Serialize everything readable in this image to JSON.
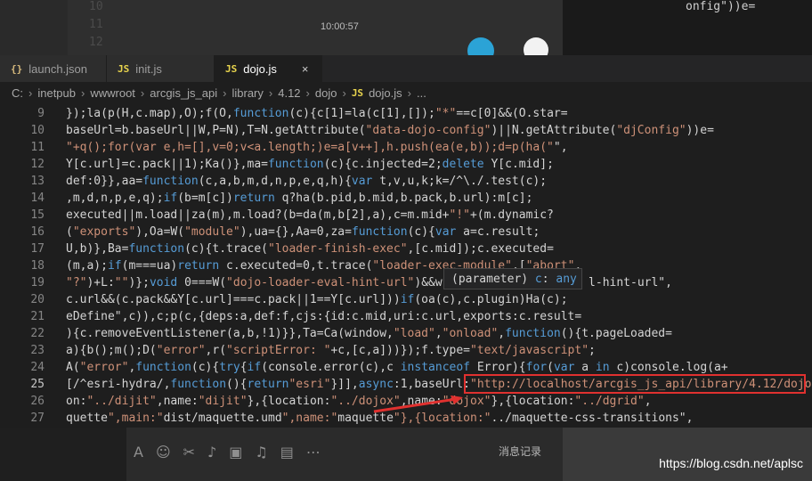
{
  "background": {
    "line_numbers": [
      "10",
      "11",
      "12"
    ],
    "right_text": "onfig\"))e=",
    "chat_time": "10:00:57",
    "chat_record_label": "消息记录",
    "watermark": "https://blog.csdn.net/aplsc"
  },
  "tabs": [
    {
      "icon": "{}",
      "label": "launch.json",
      "active": false
    },
    {
      "icon": "JS",
      "label": "init.js",
      "active": false
    },
    {
      "icon": "JS",
      "label": "dojo.js",
      "active": true,
      "close": "×"
    }
  ],
  "breadcrumb": [
    "C:",
    "inetpub",
    "wwwroot",
    "arcgis_js_api",
    "library",
    "4.12",
    "dojo",
    "dojo.js",
    "..."
  ],
  "breadcrumb_file_icon": "JS",
  "current_line": "25",
  "lines": [
    {
      "n": "9",
      "t": "});la(p(H,c.map),O);f(O,function(c){c[1]=la(c[1],[]);\"*\"==c[0]&&(O.star="
    },
    {
      "n": "10",
      "t": "baseUrl=b.baseUrl||W,P=N),T=N.getAttribute(\"data-dojo-config\")||N.getAttribute(\"djConfig\"))e="
    },
    {
      "n": "11",
      "t": "\"+q();for(var e,h=[],v=0;v<a.length;)e=a[v++],h.push(ea(e,b));d=p(ha(\"\","
    },
    {
      "n": "12",
      "t": "Y[c.url]=c.pack||1);Ka()},ma=function(c){c.injected=2;delete Y[c.mid];"
    },
    {
      "n": "13",
      "t": "def:0}},aa=function(c,a,b,m,d,n,p,e,q,h){var t,v,u,k;k=/^\\./.test(c);"
    },
    {
      "n": "14",
      "t": ",m,d,n,p,e,q);if(b=m[c])return q?ha(b.pid,b.mid,b.pack,b.url):m[c];"
    },
    {
      "n": "15",
      "t": "executed||m.load||za(m),m.load?(b=da(m,b[2],a),c=m.mid+\"!\"+(m.dynamic?"
    },
    {
      "n": "16",
      "t": "(\"exports\"),Oa=W(\"module\"),ua={},Aa=0,za=function(c){var a=c.result;"
    },
    {
      "n": "17",
      "t": "U,b)},Ba=function(c){t.trace(\"loader-finish-exec\",[c.mid]);c.executed="
    },
    {
      "n": "18",
      "t": "(m,a);if(m===ua)return c.executed=0,t.trace(\"loader-exec-module\",[\"abort\","
    },
    {
      "n": "19",
      "t": "\"?\")+L:\"\")};void 0===W(\"dojo-loader-eval-hint-url\")&&w.                    l-hint-url\","
    },
    {
      "n": "20",
      "t": "c.url&&(c.pack&&Y[c.url]===c.pack||1==Y[c.url]))if(oa(c),c.plugin)Ha(c);"
    },
    {
      "n": "21",
      "t": "eDefine\",c)),c;p(c,{deps:a,def:f,cjs:{id:c.mid,uri:c.url,exports:c.result="
    },
    {
      "n": "22",
      "t": "){c.removeEventListener(a,b,!1)}},Ta=Ca(window,\"load\",\"onload\",function(){t.pageLoaded="
    },
    {
      "n": "23",
      "t": "a){b();m();D(\"error\",r(\"scriptError: \"+c,[c,a]))});f.type=\"text/javascript\";"
    },
    {
      "n": "24",
      "t": "A(\"error\",function(c){try{if(console.error(c),c instanceof Error){for(var a in c)console.log(a+"
    },
    {
      "n": "25",
      "t": "[/^esri-hydra/,function(){return\"esri\"}]],async:1,baseUrl:\"http://localhost/arcgis_js_api/library/4.12/dojo\","
    },
    {
      "n": "26",
      "t": "on:\"../dijit\",name:\"dijit\"},{location:\"../dojox\",name:\"dojox\"},{location:\"../dgrid\","
    },
    {
      "n": "27",
      "t": "quette\",main:\"dist/maquette.umd\",name:\"maquette\"},{location:\"../maquette-css-transitions\","
    }
  ],
  "hover": {
    "prefix": "(parameter)",
    "name": "c",
    "sep": ":",
    "type": "any"
  },
  "highlight_url": "\"http://localhost/arcgis_js_api/library/4.12/dojo\""
}
